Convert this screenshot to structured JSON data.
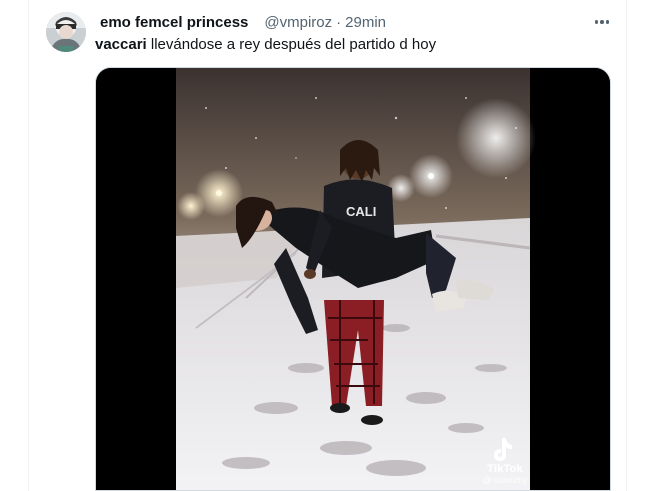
{
  "tweet": {
    "display_name": "emo femcel princess",
    "handle": "@vmpiroz",
    "separator": "·",
    "time": "29min",
    "text_mention": "vaccari",
    "text_body": " llevándose a rey después del partido d hoy",
    "more_icon": "more-horizontal-icon"
  },
  "media": {
    "watermark_label": "TikTok",
    "watermark_user": "@ vuwumy",
    "shirt_text": "CALI"
  },
  "colors": {
    "text_primary": "#0f1419",
    "text_secondary": "#536471",
    "border": "#eff3f4",
    "media_border": "#cfd9de"
  }
}
